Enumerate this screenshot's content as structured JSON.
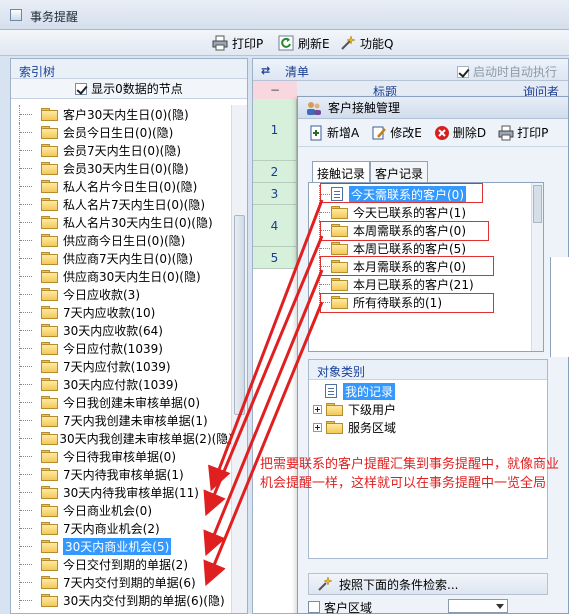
{
  "window": {
    "title": "事务提醒"
  },
  "toolbar": {
    "print": "打印P",
    "refresh": "刷新E",
    "function": "功能Q"
  },
  "left_panel": {
    "header": "索引树",
    "show_zero_label": "显示0数据的节点",
    "show_zero_checked": true,
    "items": [
      {
        "label": "客户30天内生日(0)(隐)",
        "selected": false
      },
      {
        "label": "会员今日生日(0)(隐)",
        "selected": false
      },
      {
        "label": "会员7天内生日(0)(隐)",
        "selected": false
      },
      {
        "label": "会员30天内生日(0)(隐)",
        "selected": false
      },
      {
        "label": "私人名片今日生日(0)(隐)",
        "selected": false
      },
      {
        "label": "私人名片7天内生日(0)(隐)",
        "selected": false
      },
      {
        "label": "私人名片30天内生日(0)(隐)",
        "selected": false
      },
      {
        "label": "供应商今日生日(0)(隐)",
        "selected": false
      },
      {
        "label": "供应商7天内生日(0)(隐)",
        "selected": false
      },
      {
        "label": "供应商30天内生日(0)(隐)",
        "selected": false
      },
      {
        "label": "今日应收款(3)",
        "selected": false
      },
      {
        "label": "7天内应收款(10)",
        "selected": false
      },
      {
        "label": "30天内应收款(64)",
        "selected": false
      },
      {
        "label": "今日应付款(1039)",
        "selected": false
      },
      {
        "label": "7天内应付款(1039)",
        "selected": false
      },
      {
        "label": "30天内应付款(1039)",
        "selected": false
      },
      {
        "label": "今日我创建未审核单据(0)",
        "selected": false
      },
      {
        "label": "7天内我创建未审核单据(1)",
        "selected": false
      },
      {
        "label": "30天内我创建未审核单据(2)(隐)",
        "selected": false
      },
      {
        "label": "今日待我审核单据(0)",
        "selected": false
      },
      {
        "label": "7天内待我审核单据(1)",
        "selected": false
      },
      {
        "label": "30天内待我审核单据(11)",
        "selected": false
      },
      {
        "label": "今日商业机会(0)",
        "selected": false
      },
      {
        "label": "7天内商业机会(2)",
        "selected": false
      },
      {
        "label": "30天内商业机会(5)",
        "selected": true
      },
      {
        "label": "今日交付到期的单据(2)",
        "selected": false
      },
      {
        "label": "7天内交付到期的单据(6)",
        "selected": false
      },
      {
        "label": "30天内交付到期的单据(6)(隐)",
        "selected": false
      }
    ]
  },
  "right_panel": {
    "header_label": "清单",
    "auto_run_label": "启动时自动执行",
    "auto_run_checked": true,
    "columns": [
      "标题",
      "询问者"
    ],
    "minus": "−",
    "rows": [
      "1",
      "2",
      "3",
      "4",
      "5"
    ]
  },
  "dialog": {
    "title": "客户接触管理",
    "tools": {
      "add": "新增A",
      "edit": "修改E",
      "delete": "删除D",
      "print": "打印P"
    },
    "tabs": [
      "接触记录",
      "客户记录"
    ],
    "contact_tree": [
      {
        "label": "今天需联系的客户(0)",
        "selected": true
      },
      {
        "label": "今天已联系的客户(1)",
        "selected": false
      },
      {
        "label": "本周需联系的客户(0)",
        "selected": false
      },
      {
        "label": "本周已联系的客户(5)",
        "selected": false
      },
      {
        "label": "本月需联系的客户(0)",
        "selected": false
      },
      {
        "label": "本月已联系的客户(21)",
        "selected": false
      },
      {
        "label": "所有待联系的(1)",
        "selected": false
      }
    ],
    "object_panel": {
      "header": "对象类别",
      "items": [
        "我的记录",
        "下级用户",
        "服务区域"
      ]
    },
    "search_label": "按照下面的条件检索...",
    "filter_label": "客户区域"
  },
  "annotation": "把需要联系的客户提醒汇集到事务提醒中，就像商业机会提醒一样，这样就可以在事务提醒中一览全局",
  "colors": {
    "red": "#e03030",
    "selection": "#3399ff",
    "header_blue": "#17409a"
  }
}
